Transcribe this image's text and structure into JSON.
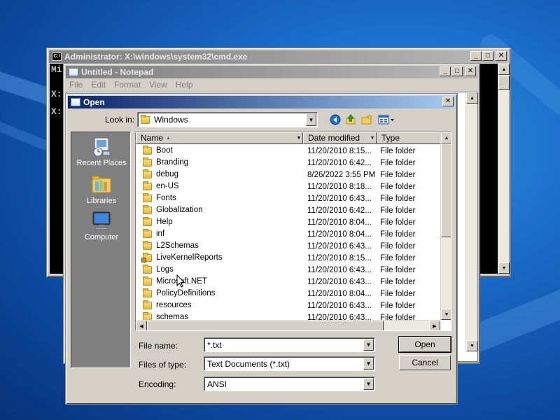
{
  "cmd": {
    "title": "Administrator: X:\\windows\\system32\\cmd.exe",
    "line1": "Mi",
    "line2": "X:",
    "line3": "X:"
  },
  "notepad": {
    "title": "Untitled - Notepad",
    "menu": [
      "File",
      "Edit",
      "Format",
      "View",
      "Help"
    ]
  },
  "dialog": {
    "title": "Open",
    "look_in_label": "Look in:",
    "look_in_value": "Windows",
    "places": [
      {
        "label": "Recent Places",
        "icon": "recent-places-icon"
      },
      {
        "label": "Libraries",
        "icon": "libraries-icon"
      },
      {
        "label": "Computer",
        "icon": "computer-icon"
      }
    ],
    "columns": [
      "Name",
      "Date modified",
      "Type"
    ],
    "files": [
      {
        "name": "Boot",
        "date": "11/20/2010 8:15...",
        "type": "File folder"
      },
      {
        "name": "Branding",
        "date": "11/20/2010 6:42...",
        "type": "File folder"
      },
      {
        "name": "debug",
        "date": "8/26/2022 3:55 PM",
        "type": "File folder"
      },
      {
        "name": "en-US",
        "date": "11/20/2010 8:18...",
        "type": "File folder"
      },
      {
        "name": "Fonts",
        "date": "11/20/2010 6:43...",
        "type": "File folder"
      },
      {
        "name": "Globalization",
        "date": "11/20/2010 6:42...",
        "type": "File folder"
      },
      {
        "name": "Help",
        "date": "11/20/2010 8:04...",
        "type": "File folder"
      },
      {
        "name": "inf",
        "date": "11/20/2010 8:04...",
        "type": "File folder"
      },
      {
        "name": "L2Schemas",
        "date": "11/20/2010 6:43...",
        "type": "File folder"
      },
      {
        "name": "LiveKernelReports",
        "date": "11/20/2010 8:15...",
        "type": "File folder"
      },
      {
        "name": "Logs",
        "date": "11/20/2010 6:43...",
        "type": "File folder"
      },
      {
        "name": "Microsoft.NET",
        "date": "11/20/2010 6:43...",
        "type": "File folder"
      },
      {
        "name": "PolicyDefinitions",
        "date": "11/20/2010 8:04...",
        "type": "File folder"
      },
      {
        "name": "resources",
        "date": "11/20/2010 6:43...",
        "type": "File folder"
      },
      {
        "name": "schemas",
        "date": "11/20/2010 6:43...",
        "type": "File folder"
      }
    ],
    "filename_label": "File name:",
    "filename_value": "*.txt",
    "filetype_label": "Files of type:",
    "filetype_value": "Text Documents (*.txt)",
    "encoding_label": "Encoding:",
    "encoding_value": "ANSI",
    "open_label": "Open",
    "cancel_label": "Cancel"
  },
  "title_buttons": {
    "minimize": "_",
    "maximize": "□",
    "close": "✕"
  }
}
